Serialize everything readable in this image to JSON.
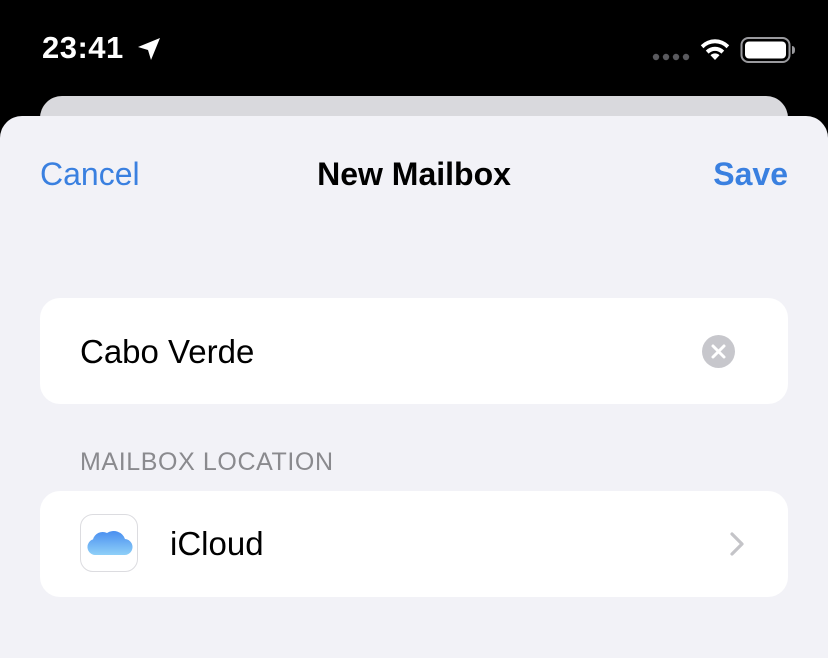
{
  "status_bar": {
    "time": "23:41",
    "icons": [
      "location-arrow-icon",
      "cellular-signal-icon",
      "wifi-icon",
      "battery-icon"
    ]
  },
  "nav": {
    "cancel_label": "Cancel",
    "title": "New Mailbox",
    "save_label": "Save"
  },
  "name_field": {
    "value": "Cabo Verde",
    "clear_icon": "clear-circle-icon"
  },
  "location_section": {
    "header": "MAILBOX LOCATION",
    "item": {
      "label": "iCloud",
      "icon": "icloud-icon",
      "accessory": "chevron-right-icon"
    }
  },
  "colors": {
    "accent": "#3a80e0",
    "sheet_background": "#f2f2f7",
    "card_background": "#ffffff",
    "secondary_text": "#8a8a8e"
  }
}
